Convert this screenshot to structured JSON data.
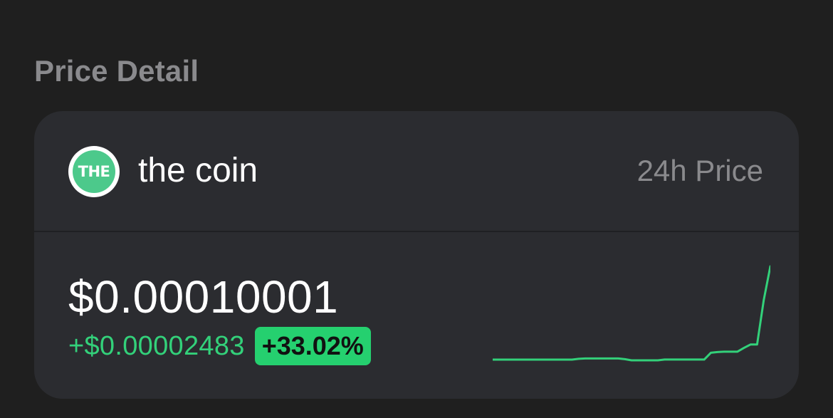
{
  "section": {
    "title": "Price Detail"
  },
  "coin": {
    "logo_text": "THE",
    "name": "the coin",
    "period_label": "24h Price",
    "price": "$0.00010001",
    "change_abs": "+$0.00002483",
    "change_pct": "+33.02%"
  },
  "colors": {
    "background": "#1f1f1f",
    "card": "#2b2c30",
    "positive": "#33d17a",
    "badge": "#25d06f",
    "muted": "#8a8a8d",
    "logo": "#4cc98b"
  },
  "chart_data": {
    "type": "line",
    "title": "",
    "series": [
      {
        "values": [
          7.518e-05,
          7.518e-05,
          7.518e-05,
          7.518e-05,
          7.518e-05,
          7.518e-05,
          7.518e-05,
          7.518e-05,
          7.518e-05,
          7.518e-05,
          7.518e-05,
          7.518e-05,
          7.518e-05,
          7.54e-05,
          7.55e-05,
          7.55e-05,
          7.55e-05,
          7.55e-05,
          7.55e-05,
          7.55e-05,
          7.53e-05,
          7.5e-05,
          7.5e-05,
          7.5e-05,
          7.5e-05,
          7.5e-05,
          7.52e-05,
          7.52e-05,
          7.52e-05,
          7.52e-05,
          7.52e-05,
          7.52e-05,
          7.52e-05,
          7.7e-05,
          7.72e-05,
          7.73e-05,
          7.73e-05,
          7.73e-05,
          7.83e-05,
          7.92e-05,
          7.92e-05,
          9.1e-05,
          0.00010001
        ]
      }
    ]
  }
}
